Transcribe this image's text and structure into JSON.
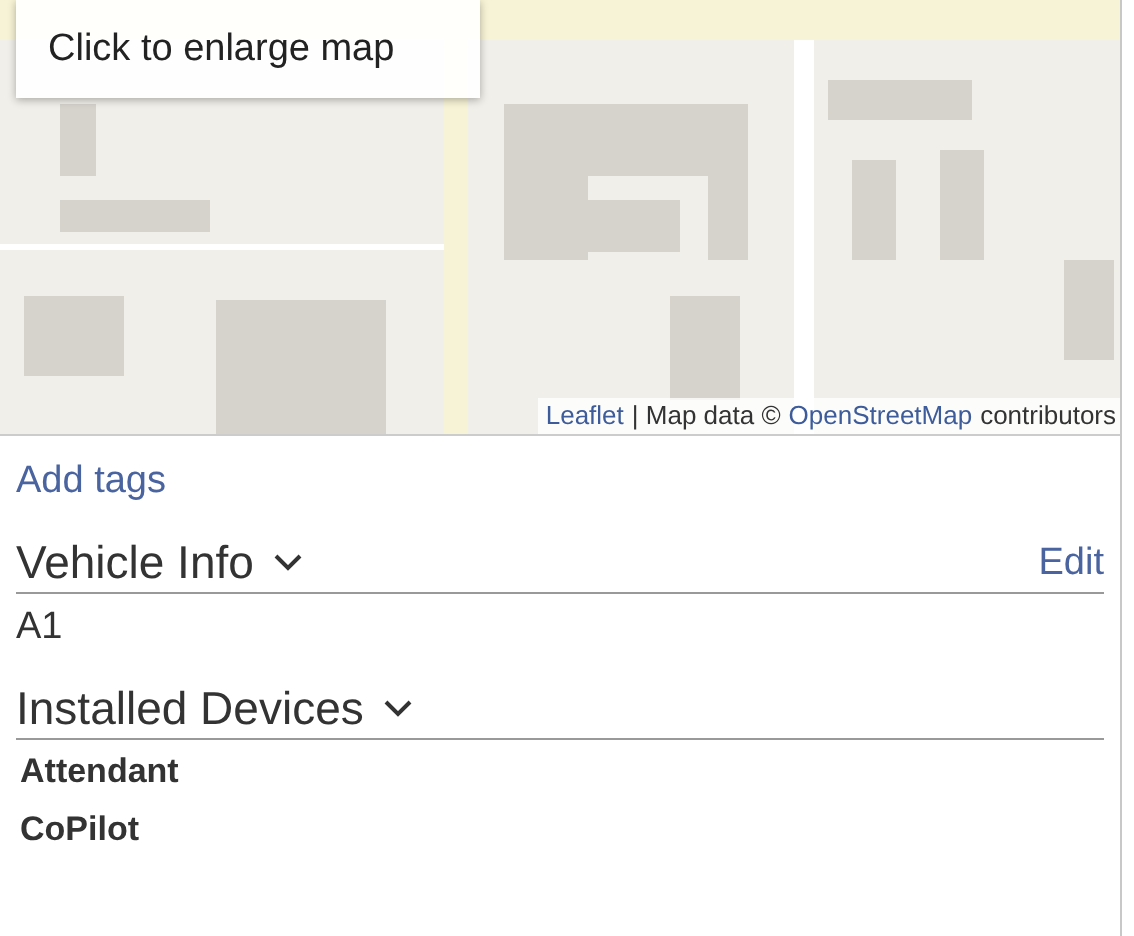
{
  "map": {
    "enlarge_button": "Click to enlarge map",
    "attribution": [
      {
        "kind": "link",
        "text": "Leaflet"
      },
      {
        "kind": "text",
        "text": "| Map data ©"
      },
      {
        "kind": "link",
        "text": "OpenStreetMap"
      },
      {
        "kind": "text",
        "text": "contributors"
      }
    ]
  },
  "add_tags": "Add tags",
  "sections": [
    {
      "title": "Vehicle Info",
      "expanded": true,
      "action": "Edit",
      "kind": "info",
      "items": [
        "A1"
      ]
    },
    {
      "title": "Installed Devices",
      "expanded": true,
      "kind": "devices",
      "items": [
        "Attendant",
        "CoPilot"
      ]
    }
  ]
}
